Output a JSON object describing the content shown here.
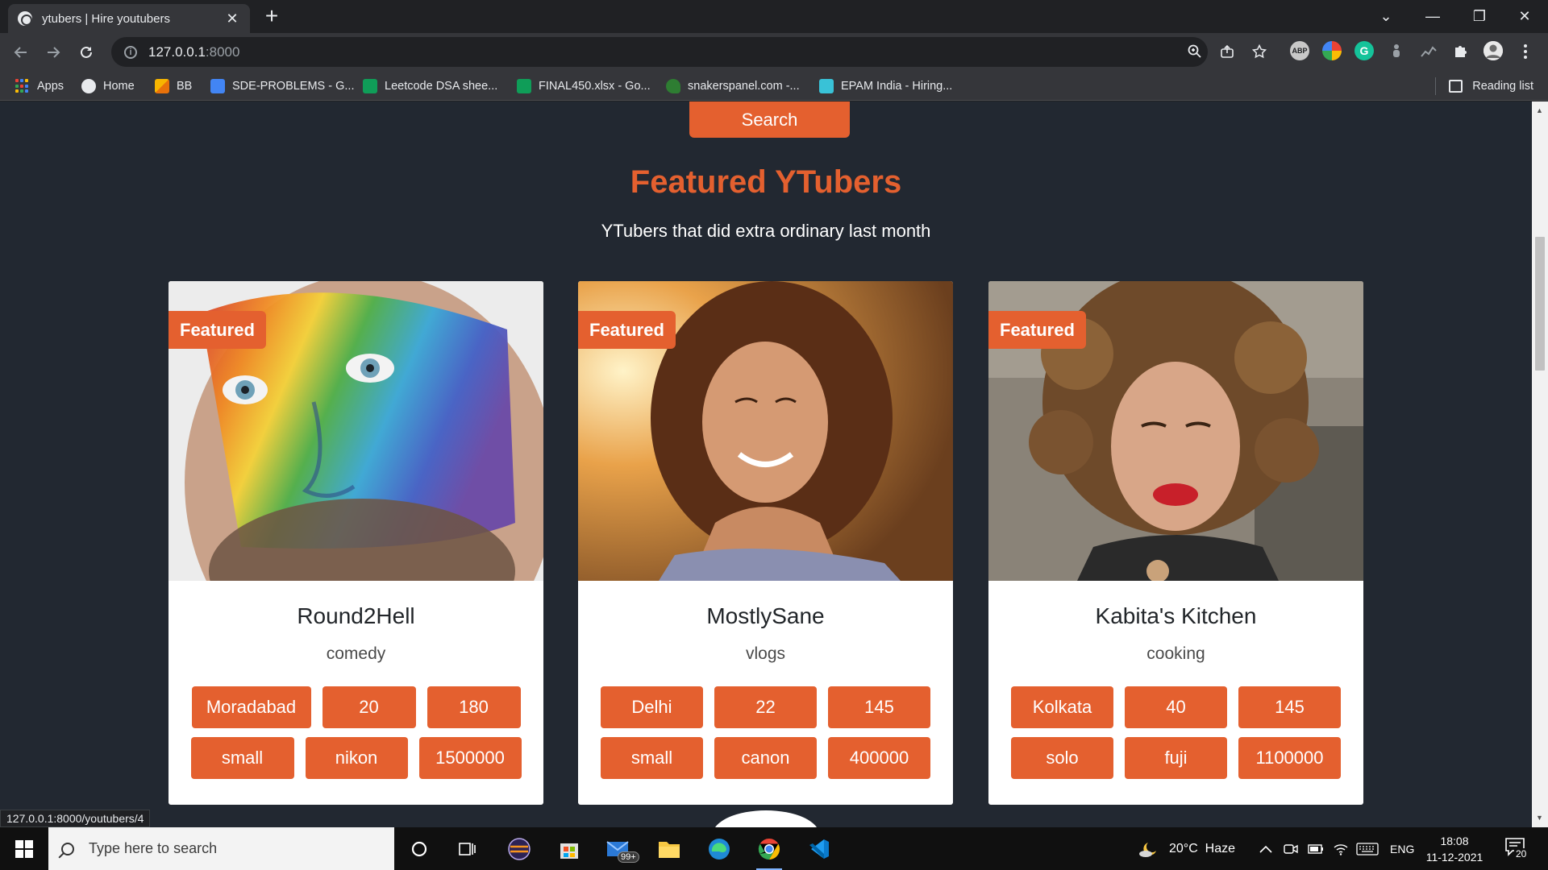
{
  "browser": {
    "tab_title": "ytubers | Hire youtubers",
    "tab_close": "✕",
    "new_tab": "+",
    "url_host": "127.0.0.1",
    "url_port": ":8000",
    "window_controls": [
      "⌄",
      "—",
      "❐",
      "✕"
    ],
    "extensions": [
      "ABP"
    ],
    "bookmarks": [
      {
        "label": "Apps",
        "icon": "apps-grid-icon"
      },
      {
        "label": "Home",
        "icon": "globe-icon"
      },
      {
        "label": "BB",
        "icon": "pencil-icon"
      },
      {
        "label": "SDE-PROBLEMS - G...",
        "icon": "docs-icon"
      },
      {
        "label": "Leetcode DSA shee...",
        "icon": "sheets-icon"
      },
      {
        "label": "FINAL450.xlsx - Go...",
        "icon": "sheets-icon"
      },
      {
        "label": "snakerspanel.com -...",
        "icon": "snake-icon"
      },
      {
        "label": "EPAM India - Hiring...",
        "icon": "epam-icon"
      }
    ],
    "reading_list": "Reading list"
  },
  "page": {
    "search_button": "Search",
    "title": "Featured YTubers",
    "subtitle": "YTubers that did extra ordinary last month",
    "cards": [
      {
        "badge": "Featured",
        "name": "Round2Hell",
        "category": "comedy",
        "city": "Moradabad",
        "age": "20",
        "height": "180",
        "crew": "small",
        "camera": "nikon",
        "price": "1500000"
      },
      {
        "badge": "Featured",
        "name": "MostlySane",
        "category": "vlogs",
        "city": "Delhi",
        "age": "22",
        "height": "145",
        "crew": "small",
        "camera": "canon",
        "price": "400000"
      },
      {
        "badge": "Featured",
        "name": "Kabita's Kitchen",
        "category": "cooking",
        "city": "Kolkata",
        "age": "40",
        "height": "145",
        "crew": "solo",
        "camera": "fuji",
        "price": "1100000"
      }
    ],
    "status_link": "127.0.0.1:8000/youtubers/4"
  },
  "taskbar": {
    "search_placeholder": "Type here to search",
    "mail_badge": "99+",
    "weather": "20°C  Haze",
    "language": "ENG",
    "time": "18:08",
    "date": "11-12-2021",
    "notification_count": "20"
  },
  "colors": {
    "accent": "#e4602f",
    "page_bg": "#222831",
    "card_bg": "#ffffff"
  }
}
